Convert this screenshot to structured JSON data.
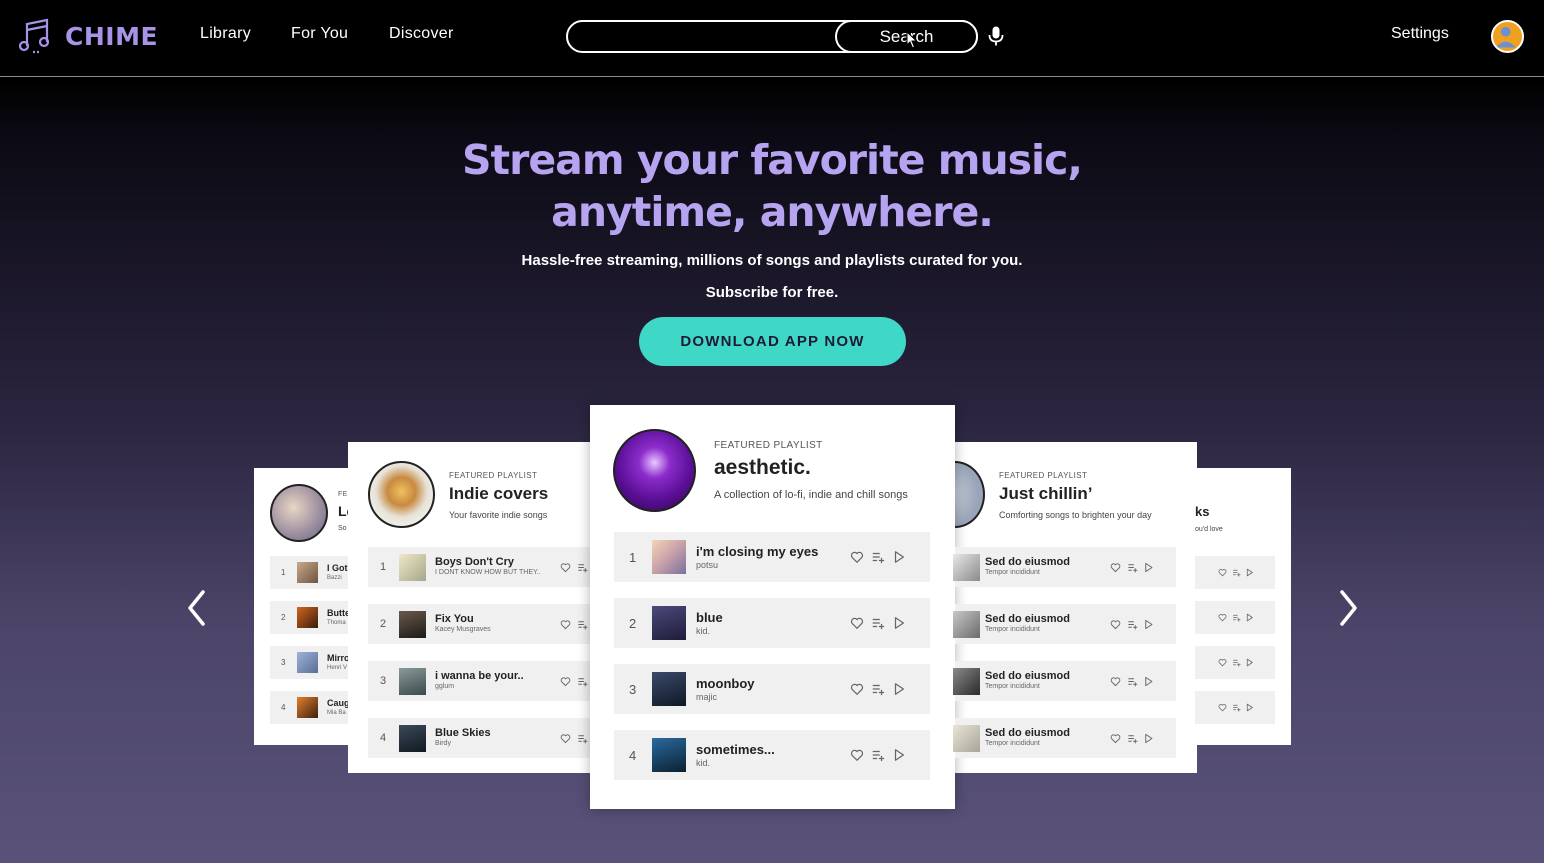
{
  "brand": {
    "name": "CHIME",
    "accent": "#a993e8"
  },
  "nav": {
    "links": [
      "Library",
      "For You",
      "Discover"
    ],
    "settings": "Settings"
  },
  "search": {
    "value": "",
    "button_label": "Search"
  },
  "hero": {
    "title_line1": "Stream your favorite music,",
    "title_line2": "anytime, anywhere.",
    "subtitle": "Hassle-free streaming, millions of songs and playlists curated for you.",
    "subscribe": "Subscribe for free.",
    "cta": "DOWNLOAD APP NOW",
    "cta_color": "#3fd8c6"
  },
  "playlists": {
    "far_left": {
      "tag": "FE",
      "name": "Le",
      "desc": "So",
      "tracks": [
        {
          "num": "1",
          "title": "I Got",
          "artist": "Bazzi"
        },
        {
          "num": "2",
          "title": "Butte",
          "artist": "Thoma"
        },
        {
          "num": "3",
          "title": "Mirro",
          "artist": "Henri V"
        },
        {
          "num": "4",
          "title": "Caug",
          "artist": "Mia Ba"
        }
      ]
    },
    "left": {
      "tag": "FEATURED PLAYLIST",
      "name": "Indie covers",
      "desc": "Your favorite indie songs",
      "tracks": [
        {
          "num": "1",
          "title": "Boys Don't Cry",
          "artist": "I DONT KNOW HOW BUT THEY.."
        },
        {
          "num": "2",
          "title": "Fix You",
          "artist": "Kacey Musgraves"
        },
        {
          "num": "3",
          "title": "i wanna be your..",
          "artist": "gglum"
        },
        {
          "num": "4",
          "title": "Blue Skies",
          "artist": "Birdy"
        }
      ]
    },
    "center": {
      "tag": "FEATURED PLAYLIST",
      "name": "aesthetic.",
      "desc": "A collection of lo-fi, indie and chill songs",
      "tracks": [
        {
          "num": "1",
          "title": "i'm closing my eyes",
          "artist": "potsu"
        },
        {
          "num": "2",
          "title": "blue",
          "artist": "kid."
        },
        {
          "num": "3",
          "title": "moonboy",
          "artist": "majic"
        },
        {
          "num": "4",
          "title": "sometimes...",
          "artist": "kid."
        }
      ]
    },
    "right": {
      "tag": "FEATURED PLAYLIST",
      "name": "Just chillin’",
      "desc": "Comforting songs to brighten your day",
      "tracks": [
        {
          "title": "Sed do eiusmod",
          "artist": "Tempor incididunt"
        },
        {
          "title": "Sed do eiusmod",
          "artist": "Tempor incididunt"
        },
        {
          "title": "Sed do eiusmod",
          "artist": "Tempor incididunt"
        },
        {
          "title": "Sed do eiusmod",
          "artist": "Tempor incididunt"
        }
      ]
    },
    "far_right": {
      "name": "ks",
      "desc": "ou'd love"
    }
  }
}
